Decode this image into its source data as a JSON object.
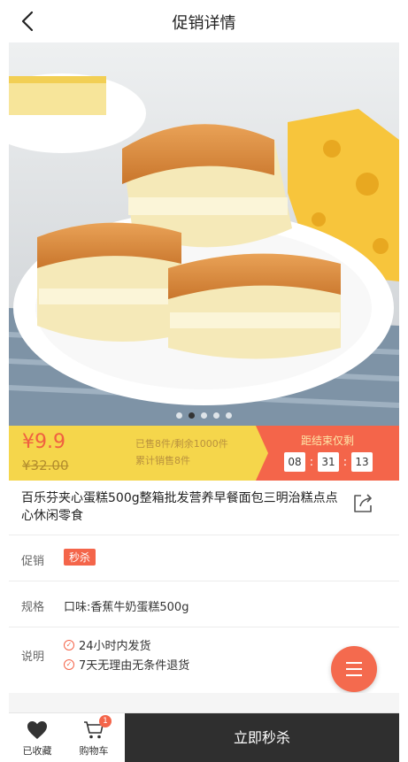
{
  "header": {
    "title": "促销详情",
    "back_icon": "chevron-left-icon"
  },
  "carousel": {
    "slide_count": 5,
    "active_index": 1
  },
  "promo": {
    "price_now": "¥9.9",
    "price_old": "¥32.00",
    "sold_line": "已售8件/剩余1000件",
    "total_line": "累计销售8件",
    "countdown_label": "距结束仅剩",
    "hours": "08",
    "minutes": "31",
    "seconds": "13",
    "accent_color": "#f4654a",
    "bar_color": "#f5d64b"
  },
  "product": {
    "title": "百乐芬夹心蛋糕500g整箱批发营养早餐面包三明治糕点点心休闲零食",
    "share_icon": "share-icon"
  },
  "details": {
    "promo_label": "促销",
    "promo_tag": "秒杀",
    "spec_label": "规格",
    "spec_value": "口味:香蕉牛奶蛋糕500g",
    "note_label": "说明",
    "notes": [
      "24小时内发货",
      "7天无理由无条件退货"
    ]
  },
  "bottom_bar": {
    "favorite_label": "已收藏",
    "cart_label": "购物车",
    "cart_badge": "1",
    "buy_label": "立即秒杀"
  }
}
